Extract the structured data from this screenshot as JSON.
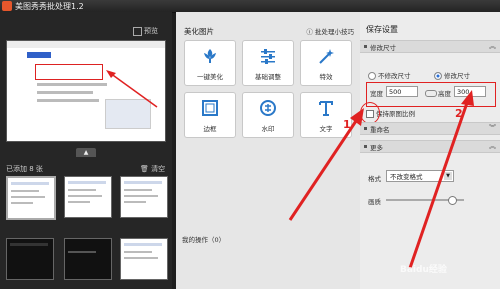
{
  "window": {
    "title": "美图秀秀批处理1.2"
  },
  "left": {
    "enlarge_label": "预览",
    "added_label": "已添加 8 张",
    "clear_label": "清空"
  },
  "middle": {
    "section_title": "美化图片",
    "help_link": "批处理小技巧",
    "tools": [
      {
        "label": "一键美化",
        "icon": "flower-icon"
      },
      {
        "label": "基础调整",
        "icon": "sliders-icon"
      },
      {
        "label": "特效",
        "icon": "magic-wand-icon"
      },
      {
        "label": "边框",
        "icon": "frame-icon"
      },
      {
        "label": "水印",
        "icon": "watermark-icon"
      },
      {
        "label": "文字",
        "icon": "text-T-icon"
      }
    ],
    "my_ops": "我的操作（0）"
  },
  "right": {
    "title": "保存设置",
    "sections": {
      "resize": "修改尺寸",
      "rename": "重命名",
      "more": "更多"
    },
    "radio_keep": "不修改尺寸",
    "radio_change": "修改尺寸",
    "width_label": "宽度",
    "width_value": "500",
    "height_label": "高度",
    "height_value": "300",
    "keep_ratio": "保持原图比例",
    "format_label": "格式",
    "format_value": "不改变格式",
    "quality_label": "画质",
    "quality_level": 0.8
  },
  "annotations": {
    "marker1": "1",
    "marker2": "2",
    "watermark": "Baidu经验"
  },
  "colors": {
    "annotation_red": "#e02222",
    "dark_bg": "#1e1e1e",
    "panel_light": "#e6e6e6"
  }
}
